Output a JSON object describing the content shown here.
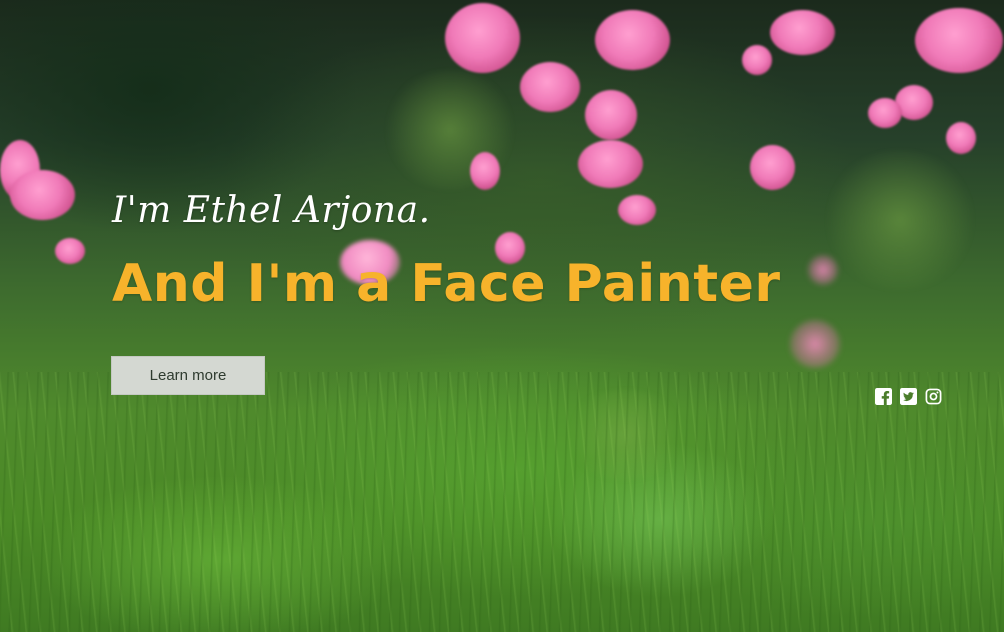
{
  "hero": {
    "intro": "I'm Ethel Arjona.",
    "headline": "And I'm a Face Painter",
    "cta_label": "Learn more"
  },
  "social": {
    "icons": [
      "facebook-icon",
      "twitter-icon",
      "instagram-icon"
    ]
  },
  "colors": {
    "headline": "#f7b32b",
    "intro": "#ffffff",
    "button_bg": "#d4d8d2",
    "button_text": "#2e3b2f"
  }
}
